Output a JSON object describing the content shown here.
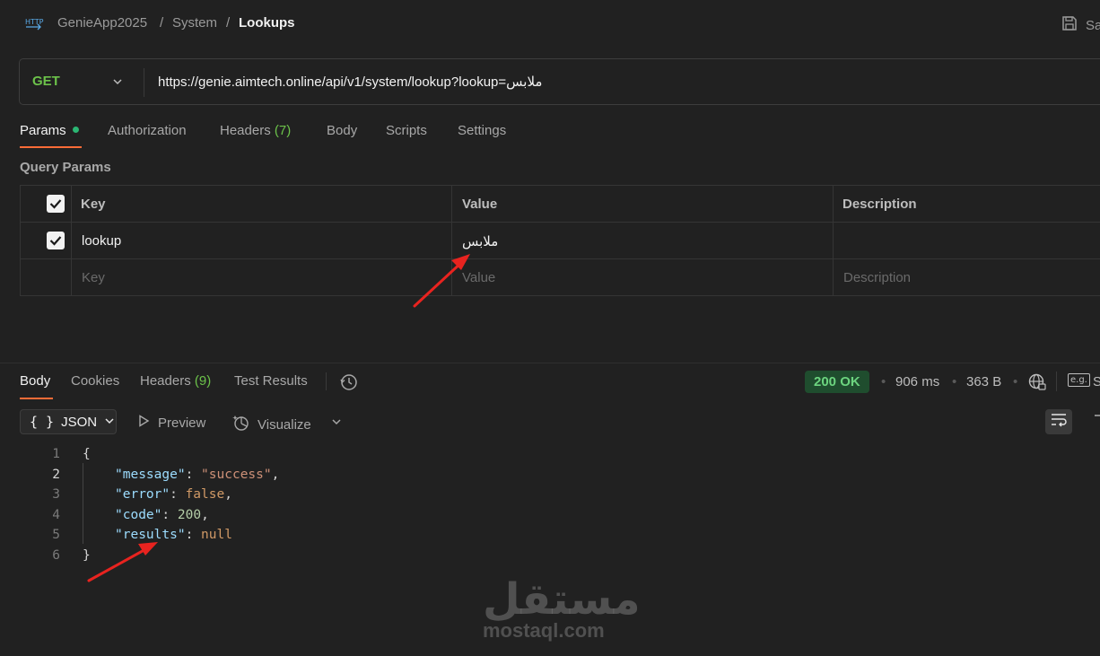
{
  "breadcrumb": {
    "collection": "GenieApp2025",
    "folder": "System",
    "request": "Lookups",
    "separator": "/"
  },
  "header": {
    "save_label": "Sa"
  },
  "request": {
    "method": "GET",
    "url": "https://genie.aimtech.online/api/v1/system/lookup?lookup=ملابس"
  },
  "request_tabs": {
    "params": "Params",
    "authorization": "Authorization",
    "headers": "Headers",
    "headers_count": "(7)",
    "body": "Body",
    "scripts": "Scripts",
    "settings": "Settings"
  },
  "query_params": {
    "title": "Query Params",
    "columns": {
      "key": "Key",
      "value": "Value",
      "description": "Description"
    },
    "rows": [
      {
        "checked": true,
        "key": "lookup",
        "value": "ملابس",
        "description": ""
      }
    ],
    "placeholders": {
      "key": "Key",
      "value": "Value",
      "description": "Description"
    }
  },
  "response_tabs": {
    "body": "Body",
    "cookies": "Cookies",
    "headers": "Headers",
    "headers_count": "(9)",
    "test_results": "Test Results"
  },
  "response_meta": {
    "status": "200 OK",
    "time": "906 ms",
    "size": "363 B",
    "example_label": "e.g.",
    "save_fragment": "S"
  },
  "format": {
    "braces": "{ }",
    "type": "JSON",
    "preview": "Preview",
    "visualize": "Visualize"
  },
  "response_body": {
    "line_numbers": [
      "1",
      "2",
      "3",
      "4",
      "5",
      "6"
    ],
    "open": "{",
    "close": "}",
    "message_key": "\"message\"",
    "message_value": "\"success\"",
    "error_key": "\"error\"",
    "error_value": "false",
    "code_key": "\"code\"",
    "code_value": "200",
    "results_key": "\"results\"",
    "results_value": "null"
  },
  "watermark": {
    "arabic": "مستقل",
    "latin": "mostaql.com"
  },
  "colors": {
    "accent": "#ff6c37",
    "method": "#6cc24a",
    "status_ok": "#6cd47f"
  }
}
